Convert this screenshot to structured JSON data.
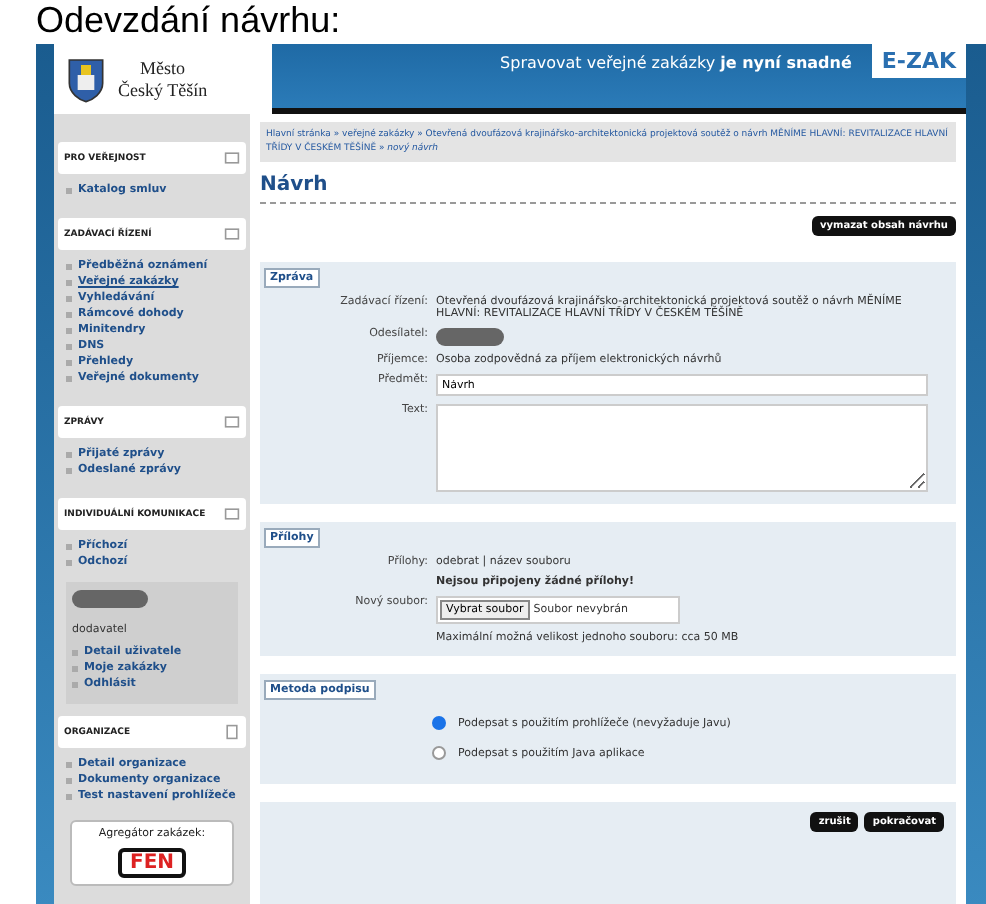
{
  "page_heading": "Odevzdání návrhu:",
  "header": {
    "city_name": "Město",
    "city_name_2": "Český Těšín",
    "slogan": "Spravovat veřejné zakázky ",
    "slogan_bold": "je nyní snadné",
    "brand": "E-ZAK"
  },
  "sidebar": {
    "sections": [
      {
        "title": "PRO VEŘEJNOST",
        "items": [
          {
            "label": "Katalog smluv",
            "current": false
          }
        ]
      },
      {
        "title": "ZADÁVACÍ ŘÍZENÍ",
        "items": [
          {
            "label": "Předběžná oznámení",
            "current": false
          },
          {
            "label": "Veřejné zakázky",
            "current": true
          },
          {
            "label": "Vyhledávání",
            "current": false
          },
          {
            "label": "Rámcové dohody",
            "current": false
          },
          {
            "label": "Minitendry",
            "current": false
          },
          {
            "label": "DNS",
            "current": false
          },
          {
            "label": "Přehledy",
            "current": false
          },
          {
            "label": "Veřejné dokumenty",
            "current": false
          }
        ]
      },
      {
        "title": "ZPRÁVY",
        "items": [
          {
            "label": "Přijaté zprávy",
            "current": false
          },
          {
            "label": "Odeslané zprávy",
            "current": false
          }
        ]
      },
      {
        "title": "INDIVIDUÁLNÍ KOMUNIKACE",
        "items": [
          {
            "label": "Příchozí",
            "current": false
          },
          {
            "label": "Odchozí",
            "current": false
          }
        ]
      }
    ],
    "user": {
      "role": "dodavatel",
      "items": [
        {
          "label": "Detail uživatele"
        },
        {
          "label": "Moje zakázky"
        },
        {
          "label": "Odhlásit"
        }
      ]
    },
    "organization": {
      "title": "ORGANIZACE",
      "items": [
        {
          "label": "Detail organizace"
        },
        {
          "label": "Dokumenty organizace"
        },
        {
          "label": "Test nastavení prohlížeče"
        }
      ]
    },
    "aggregator": {
      "title": "Agregátor zakázek:",
      "logo": "FEN"
    }
  },
  "breadcrumb": "Hlavní stránka » veřejné zakázky » Otevřená dvoufázová krajinářsko-architektonická projektová soutěž o návrh MĚNÍME HLAVNÍ: REVITALIZACE HLAVNÍ TŘÍDY V ČESKÉM TĚŠÍNĚ » *nový návrh*",
  "title": "Návrh",
  "clear_button": "vymazat obsah návrhu",
  "message": {
    "legend": "Zpráva",
    "procedure_label": "Zadávací řízení:",
    "procedure": "Otevřená dvoufázová krajinářsko-architektonická projektová soutěž o návrh MĚNÍME HLAVNÍ: REVITALIZACE HLAVNÍ TŘÍDY V ČESKÉM TĚŠÍNĚ",
    "sender_label": "Odesílatel:",
    "recipient_label": "Příjemce:",
    "recipient": "Osoba zodpovědná za příjem elektronických návrhů",
    "subject_label": "Předmět:",
    "subject": "Návrh",
    "text_label": "Text:"
  },
  "attachments": {
    "legend": "Přílohy",
    "label": "Přílohy:",
    "columns": "odebrat | název souboru",
    "empty": "Nejsou připojeny žádné přílohy!",
    "new_file_label": "Nový soubor:",
    "choose_button": "Vybrat soubor",
    "no_file": "Soubor nevybrán",
    "limit": "Maximální možná velikost jednoho souboru: cca 50 MB"
  },
  "signing": {
    "legend": "Metoda podpisu",
    "options": [
      {
        "label": "Podepsat s použitím prohlížeče (nevyžaduje Javu)",
        "selected": true
      },
      {
        "label": "Podepsat s použitím Java aplikace",
        "selected": false
      }
    ]
  },
  "actions": [
    "zrušit",
    "pokračovat"
  ]
}
